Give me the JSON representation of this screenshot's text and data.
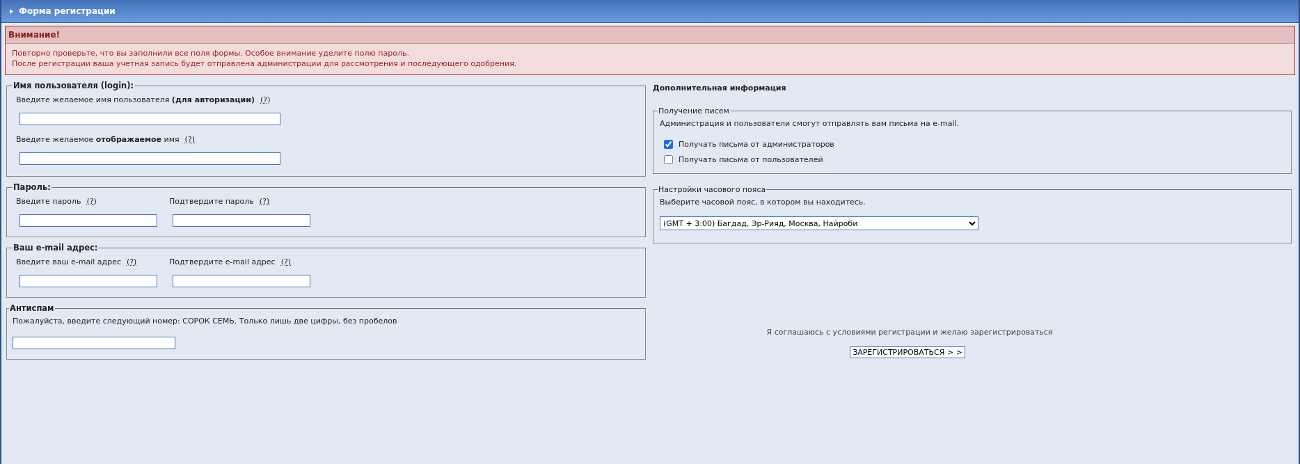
{
  "header": {
    "title": "Форма регистрации"
  },
  "warning": {
    "title": "Внимание!",
    "lines": [
      "Повторно проверьте, что вы заполнили все поля формы. Особое внимание уделите полю пароль.",
      "После регистрации ваша учетная запись будет отправлена администрации для рассмотрения и последующего одобрения."
    ]
  },
  "left_fieldsets": [
    {
      "kind": "single",
      "legend": "Имя пользователя (login):",
      "fields": [
        {
          "label": "Введите желаемое имя пользователя **(для авторизации)**",
          "help": "(?)"
        },
        {
          "label": "Введите желаемое **отображаемое** имя",
          "help": "(?)"
        }
      ]
    },
    {
      "kind": "pair",
      "legend": "Пароль:",
      "fields": [
        {
          "label": "Введите пароль",
          "help": "(?)"
        },
        {
          "label": "Подтвердите пароль",
          "help": "(?)"
        }
      ]
    },
    {
      "kind": "pair",
      "legend": "Ваш e-mail адрес:",
      "fields": [
        {
          "label": "Введите ваш e-mail адрес",
          "help": "(?)"
        },
        {
          "label": "Подтвердите e-mail адрес",
          "help": "(?)"
        }
      ]
    },
    {
      "kind": "antispam",
      "legend": "Антиспам",
      "description": "Пожалуйста, введите следующий номер: СОРОК СЕМЬ. Только лишь две цифры, без пробелов"
    }
  ],
  "additional": {
    "title": "Дополнительная информация",
    "mail": {
      "legend": "Получение писем",
      "description": "Администрация и пользователи смогут отправлять вам письма на e-mail.",
      "options": [
        {
          "label": "Получать письма от администраторов",
          "checked": true
        },
        {
          "label": "Получать письма от пользователей",
          "checked": false
        }
      ]
    },
    "timezone": {
      "legend": "Настройки часового пояса",
      "description": "Выберите часовой пояс, в котором вы находитесь.",
      "value": "(GMT + 3:00) Багдад, Эр-Рияд, Москва, Найроби"
    }
  },
  "footer": {
    "agreement": "Я соглашаюсь с условиями регистрации и желаю зарегистрироваться",
    "button": "ЗАРЕГИСТРИРОВАТЬСЯ > >"
  }
}
